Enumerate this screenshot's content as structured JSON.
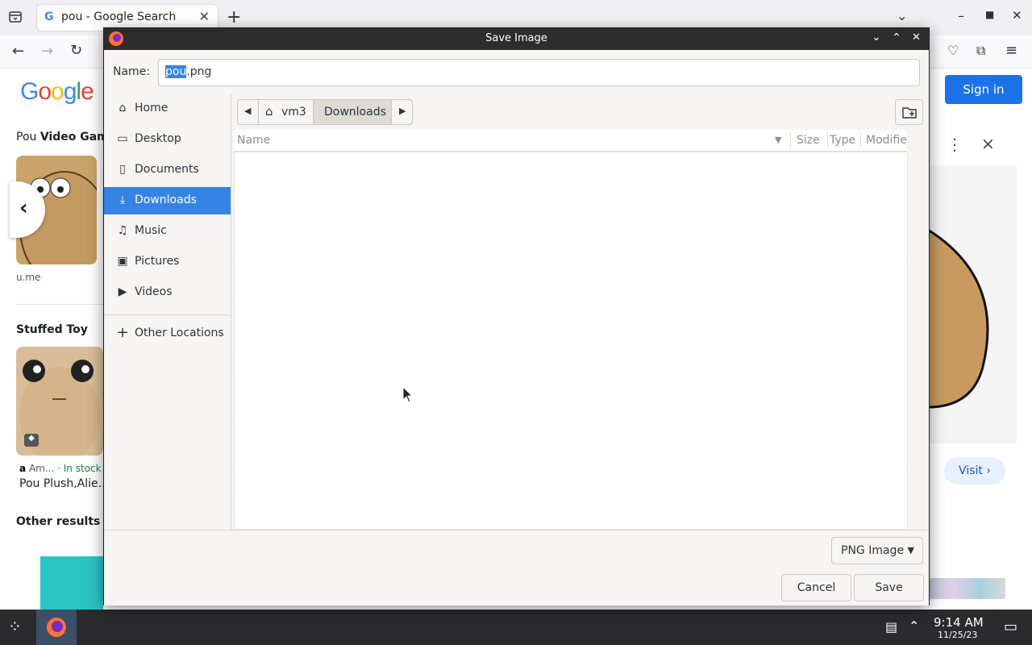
{
  "browser": {
    "tab_title": "pou - Google Search",
    "tab_favicon": "G",
    "new_tab_icon": "+",
    "sign_in": "Sign in",
    "google_logo": "Google"
  },
  "page_behind": {
    "section1_title_prefix": "Pou ",
    "section1_title_bold": "Video Game",
    "site_text": "u.me",
    "section2_title": "Stuffed Toy",
    "store_text": "Am...",
    "stock_text": "· In stock",
    "product_title": "Pou Plush,Alie...",
    "section3_title": "Other results",
    "visit_button": "Visit"
  },
  "dialog": {
    "title": "Save Image",
    "name_label": "Name:",
    "filename_selected": "pou",
    "filename_rest": ".png",
    "sidebar": [
      {
        "label": "Home",
        "icon": "home-icon",
        "glyph": "⌂"
      },
      {
        "label": "Desktop",
        "icon": "folder-icon",
        "glyph": "▭"
      },
      {
        "label": "Documents",
        "icon": "document-icon",
        "glyph": "▯"
      },
      {
        "label": "Downloads",
        "icon": "download-icon",
        "glyph": "⤓"
      },
      {
        "label": "Music",
        "icon": "music-icon",
        "glyph": "♫"
      },
      {
        "label": "Pictures",
        "icon": "picture-icon",
        "glyph": "▣"
      },
      {
        "label": "Videos",
        "icon": "video-icon",
        "glyph": "▶"
      }
    ],
    "other_locations": "Other Locations",
    "path": {
      "home_segment": "vm3",
      "current_segment": "Downloads"
    },
    "columns": [
      "Name",
      "Size",
      "Type",
      "Modifie"
    ],
    "file_type": "PNG Image",
    "cancel": "Cancel",
    "save": "Save"
  },
  "taskbar": {
    "time": "9:14 AM",
    "date": "11/25/23"
  },
  "colors": {
    "accent": "#3584e4",
    "titlebar": "#2d2d2d",
    "google_blue": "#1a73e8"
  }
}
